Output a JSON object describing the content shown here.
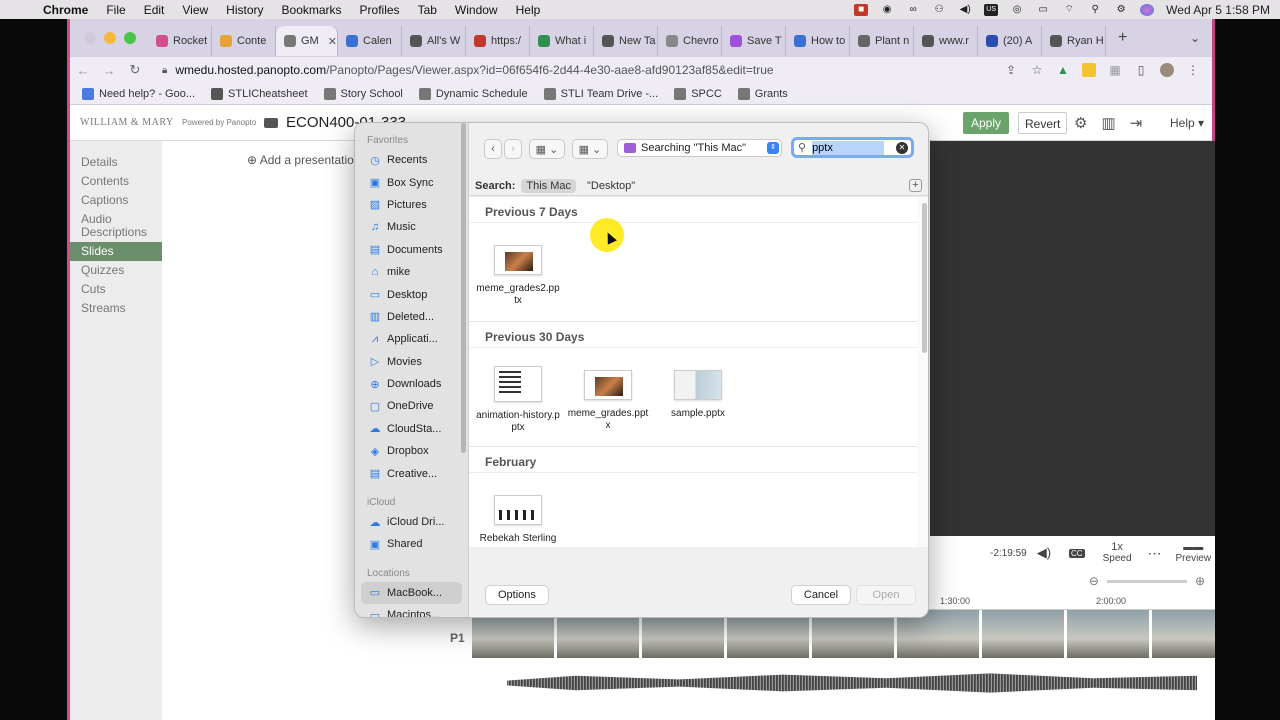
{
  "menubar": {
    "app": "Chrome",
    "items": [
      "File",
      "Edit",
      "View",
      "History",
      "Bookmarks",
      "Profiles",
      "Tab",
      "Window",
      "Help"
    ],
    "clock": "Wed Apr 5  1:58 PM"
  },
  "tabs": [
    {
      "label": "Rocket",
      "color": "#d24e8c"
    },
    {
      "label": "Conte",
      "color": "#e8a23a"
    },
    {
      "label": "GM",
      "color": "#777777",
      "active": true
    },
    {
      "label": "Calen",
      "color": "#3b6fd4"
    },
    {
      "label": "All's W",
      "color": "#555555"
    },
    {
      "label": "https:/",
      "color": "#c0392b"
    },
    {
      "label": "What i",
      "color": "#2f8f4e"
    },
    {
      "label": "New Ta",
      "color": "#555555"
    },
    {
      "label": "Chevro",
      "color": "#888888"
    },
    {
      "label": "Save T",
      "color": "#a04fd8"
    },
    {
      "label": "How to",
      "color": "#3b6fd4"
    },
    {
      "label": "Plant n",
      "color": "#666666"
    },
    {
      "label": "www.r",
      "color": "#555555"
    },
    {
      "label": "(20) A",
      "color": "#2a4db0"
    },
    {
      "label": "Ryan H",
      "color": "#555555"
    }
  ],
  "url": {
    "host": "wmedu.hosted.panopto.com",
    "path": "/Panopto/Pages/Viewer.aspx?id=06f654f6-2d44-4e30-aae8-afd90123af85&edit=true"
  },
  "bookmarks": [
    {
      "label": "Need help? - Goo...",
      "color": "#4a7be0"
    },
    {
      "label": "STLICheatsheet",
      "color": "#555555"
    },
    {
      "label": "Story School",
      "color": "#777777"
    },
    {
      "label": "Dynamic Schedule",
      "color": "#777777"
    },
    {
      "label": "STLI Team Drive -...",
      "color": "#777777"
    },
    {
      "label": "SPCC",
      "color": "#777777"
    },
    {
      "label": "Grants",
      "color": "#777777"
    }
  ],
  "panopto": {
    "logo": "WILLIAM & MARY",
    "powered": "Powered by Panopto",
    "title": "ECON400-01-333",
    "apply": "Apply",
    "revert": "Revert",
    "help": "Help",
    "sidebar": [
      "Details",
      "Contents",
      "Captions",
      "Audio Descriptions",
      "Slides",
      "Quizzes",
      "Cuts",
      "Streams"
    ],
    "active_item": "Slides",
    "add_presentation": "Add a presentation",
    "remaining": "-2:19:59",
    "speed": "1x",
    "speed_label": "Speed",
    "preview": "Preview",
    "timeline_marks": [
      "1:30:00",
      "2:00:00"
    ],
    "track_label": "P1"
  },
  "dialog": {
    "favorites_title": "Favorites",
    "favorites": [
      "Recents",
      "Box Sync",
      "Pictures",
      "Music",
      "Documents",
      "mike",
      "Desktop",
      "Deleted...",
      "Applicati...",
      "Movies",
      "Downloads",
      "OneDrive",
      "CloudSta...",
      "Dropbox",
      "Creative..."
    ],
    "icloud_title": "iCloud",
    "icloud": [
      "iCloud Dri...",
      "Shared"
    ],
    "locations_title": "Locations",
    "locations": [
      "MacBook...",
      "Macintos..."
    ],
    "location": "Searching \"This Mac\"",
    "search_value": "pptx",
    "search_label": "Search:",
    "scope_this_mac": "This Mac",
    "scope_desktop": "\"Desktop\"",
    "groups": [
      {
        "title": "Previous 7 Days",
        "files": [
          {
            "name": "meme_grades2.pptx",
            "kind": "meme"
          }
        ]
      },
      {
        "title": "Previous 30 Days",
        "files": [
          {
            "name": "animation-history.pptx",
            "kind": "anim"
          },
          {
            "name": "meme_grades.pptx",
            "kind": "meme"
          },
          {
            "name": "sample.pptx",
            "kind": "sample"
          }
        ]
      },
      {
        "title": "February",
        "files": [
          {
            "name": "Rebekah Sterling",
            "kind": "beck"
          }
        ]
      }
    ],
    "options": "Options",
    "cancel": "Cancel",
    "open": "Open"
  }
}
